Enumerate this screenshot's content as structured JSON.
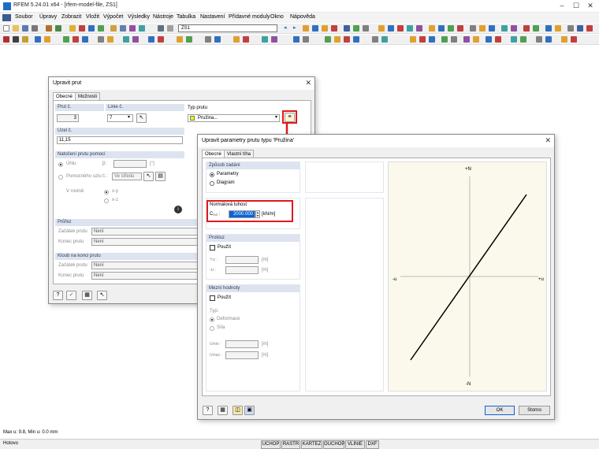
{
  "app": {
    "title": "RFEM 5.24.01 x64 - [rfem-model-file, ZS1]",
    "menu": [
      "Soubor",
      "Úpravy",
      "Zobrazit",
      "Vložit",
      "Výpočet",
      "Výsledky",
      "Nástroje",
      "Tabulka",
      "Nastavení",
      "Přídavné moduly",
      "Okno",
      "Nápověda"
    ],
    "load_case": "ZS1",
    "status_left": "Hotovo",
    "max_text": "Max u: 9.8, Min u: 0.0 mm",
    "status_buttons": [
      "UCHOP",
      "RASTR",
      "KARTEZ",
      "OUCHOP",
      "VLINIE",
      "DXF"
    ]
  },
  "member_dialog": {
    "title": "Upravit prut",
    "tabs": [
      "Obecné",
      "Možnosti"
    ],
    "member_no_label": "Prut č.",
    "member_no": "3",
    "line_no_label": "Linie č.",
    "line_no": "7",
    "member_type_label": "Typ prutu",
    "member_type": "Pružina...",
    "nodes_label": "Uzel č.",
    "nodes": "11,15",
    "rotation_label": "Natočení prutu pomocí",
    "angle_label": "Úhlu",
    "beta_label": "β:",
    "beta_unit": "[°]",
    "helpnode_label": "Pomocného uzlu",
    "helpnode_no_label": "č.:",
    "helpnode_value": "Ve středu",
    "plane_label": "V rovině:",
    "plane_xy": "x-y",
    "plane_xz": "x-z",
    "section_label": "Průřez",
    "start_label": "Začátek prutu",
    "end_label": "Konec prutu",
    "section_start": "Není",
    "section_end": "Není",
    "hinge_label": "Kloub na konci prutu",
    "hinge_start_label": "Začátek prutu",
    "hinge_end_label": "Konec prutu",
    "hinge_start": "Není",
    "hinge_end": "Není"
  },
  "spring_dialog": {
    "title": "Upravit parametry prutu typu 'Pružina'",
    "tabs": [
      "Obecné",
      "Vlastní tíha"
    ],
    "input_mode_label": "Způsob zadání",
    "opt_parameters": "Parametry",
    "opt_diagram": "Diagram",
    "stiffness_label": "Normálová tuhost",
    "c_label": "C₁,₁ :",
    "c_value": "2000.000",
    "c_unit": "[kN/m]",
    "slip_label": "Prokluz",
    "use_label": "Použít",
    "plus_u_label": "+u :",
    "minus_u_label": "-u :",
    "slip_unit": "[m]",
    "limits_label": "Mezní hodnoty",
    "limits_use_label": "Použít",
    "type_label": "Typ:",
    "opt_deformation": "Deformace",
    "opt_force": "Síla",
    "umin_label": "Umin :",
    "umax_label": "Umax :",
    "limit_unit": "[m]",
    "ok": "OK",
    "cancel": "Storno",
    "graph": {
      "plus_n": "+N",
      "minus_n": "-N",
      "minus_u": "-u",
      "plus_u": "+u"
    }
  },
  "colors": {
    "highlight": "#e0191b",
    "group_header": "#dde4ef",
    "selection": "#0a64d6",
    "yellow_swatch": "#ffff00"
  }
}
